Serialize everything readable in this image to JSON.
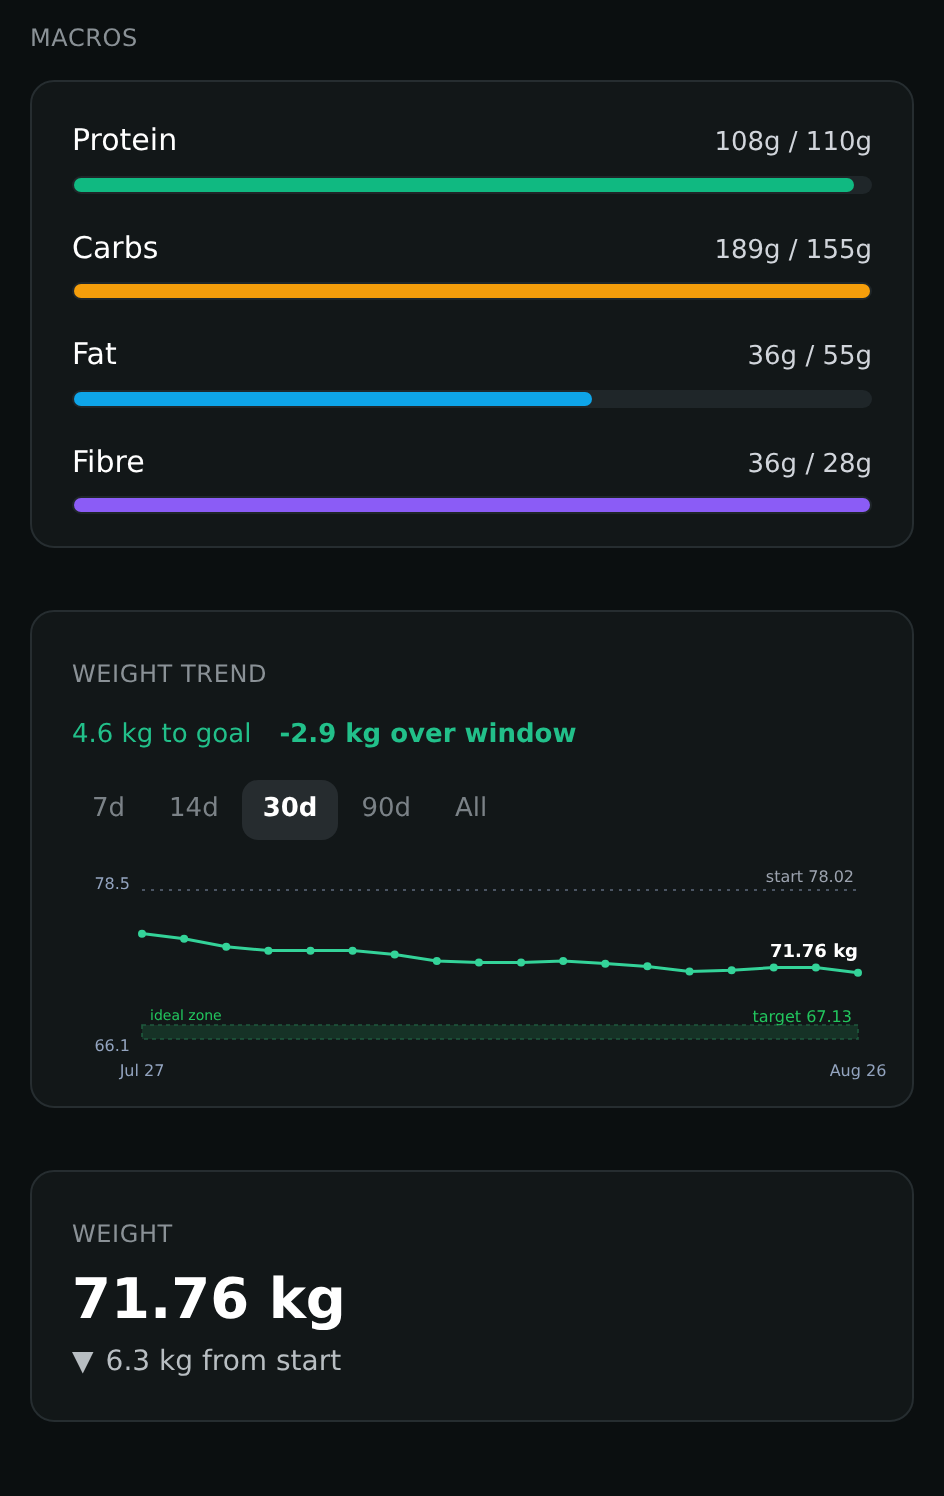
{
  "macros": {
    "title": "MACROS",
    "items": [
      {
        "name": "Protein",
        "reading": "108g / 110g",
        "level": 0.98,
        "color": "#10b981"
      },
      {
        "name": "Carbs",
        "reading": "189g / 155g",
        "level": 1,
        "color": "#f59e0b"
      },
      {
        "name": "Fat",
        "reading": "36g / 55g",
        "level": 0.65,
        "color": "#0ea5e9"
      },
      {
        "name": "Fibre",
        "reading": "36g / 28g",
        "level": 1,
        "color": "#8b5cf6"
      }
    ]
  },
  "weight_trend": {
    "title": "WEIGHT TREND",
    "to_goal": "4.6 kg to goal",
    "change": "-2.9 kg over window",
    "ranges": [
      {
        "label": "7d",
        "selected": false
      },
      {
        "label": "14d",
        "selected": false
      },
      {
        "label": "30d",
        "selected": true
      },
      {
        "label": "90d",
        "selected": false
      },
      {
        "label": "All",
        "selected": false
      }
    ],
    "chart_labels": {
      "start": "start 78.02",
      "target": "target 67.13",
      "zone": "ideal zone",
      "last": "71.76 kg"
    },
    "chart_data": {
      "type": "line",
      "categories": [
        "Jul 27",
        null,
        null,
        null,
        null,
        null,
        null,
        null,
        null,
        null,
        null,
        null,
        null,
        null,
        null,
        null,
        null,
        "Aug 26"
      ],
      "series": [
        {
          "color": "#34d399",
          "marker": "circle",
          "values": [
            74.7,
            74.3,
            73.7,
            73.4,
            73.4,
            73.4,
            73.1,
            72.6,
            72.5,
            72.5,
            72.6,
            72.4,
            72.2,
            71.8,
            71.9,
            72.1,
            72.1,
            71.7
          ]
        }
      ],
      "ylim": [
        66.1,
        78.5
      ],
      "yticks": [
        66.1,
        78.5
      ]
    }
  },
  "weight": {
    "title": "WEIGHT",
    "value": "71.76 kg",
    "delta_icon": "▼",
    "delta": "6.3 kg from start"
  }
}
